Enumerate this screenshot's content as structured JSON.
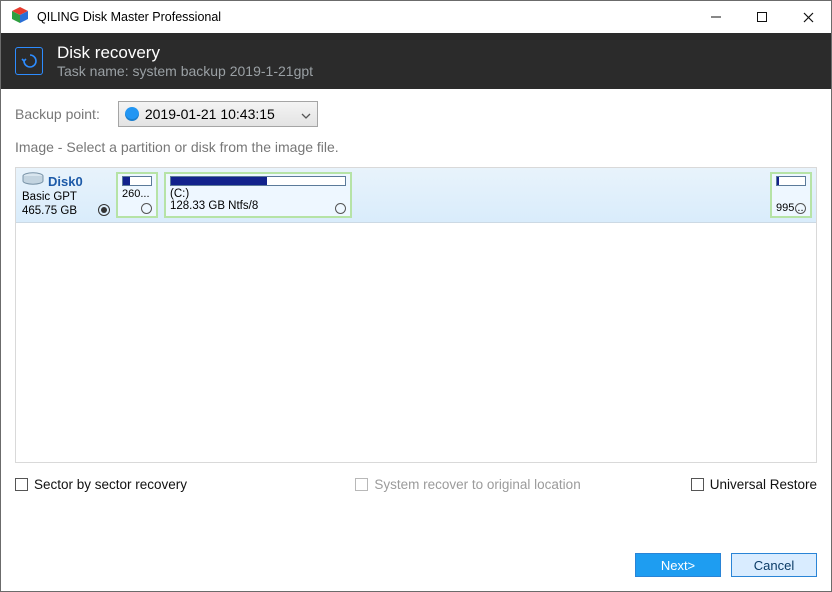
{
  "window": {
    "title": "QILING Disk Master Professional"
  },
  "header": {
    "title": "Disk recovery",
    "subtitle": "Task name: system backup 2019-1-21gpt"
  },
  "backup": {
    "label": "Backup point:",
    "selected": "2019-01-21 10:43:15"
  },
  "image_note": "Image - Select a partition or disk from the image file.",
  "disk": {
    "name": "Disk0",
    "type": "Basic GPT",
    "size": "465.75 GB",
    "partitions": {
      "small": {
        "label": "260...",
        "fill_pct": 24
      },
      "main": {
        "drive": "(C:)",
        "detail": "128.33 GB Ntfs/8",
        "fill_pct": 55
      },
      "tail": {
        "label": "995...",
        "fill_pct": 8
      }
    }
  },
  "options": {
    "sector": "Sector by sector recovery",
    "system_orig": "System recover to original location",
    "universal": "Universal Restore"
  },
  "actions": {
    "next": "Next>",
    "cancel": "Cancel"
  }
}
